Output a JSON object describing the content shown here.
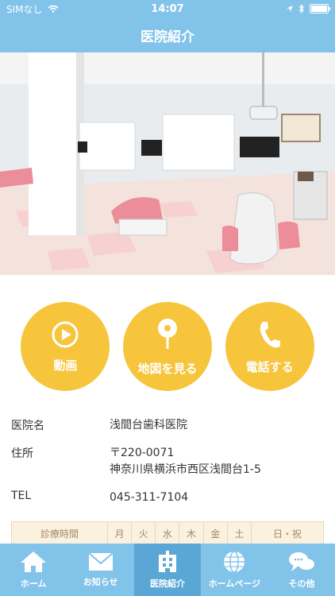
{
  "status": {
    "carrier": "SIMなし",
    "time": "14:07"
  },
  "navbar": {
    "title": "医院紹介"
  },
  "actions": [
    {
      "label": "動画",
      "icon": "play-icon"
    },
    {
      "label": "地図を見る",
      "icon": "map-pin-icon"
    },
    {
      "label": "電話する",
      "icon": "phone-icon"
    }
  ],
  "info": {
    "name_key": "医院名",
    "name_value": "浅間台歯科医院",
    "address_key": "住所",
    "address_zip": "〒220-0071",
    "address_line": "神奈川県横浜市西区浅間台1-5",
    "tel_key": "TEL",
    "tel_value": "045-311-7104"
  },
  "hours": {
    "header": [
      "診療時間",
      "月",
      "火",
      "水",
      "木",
      "金",
      "土",
      "日・祝"
    ]
  },
  "tabs": [
    {
      "label": "ホーム",
      "icon": "home-icon"
    },
    {
      "label": "お知らせ",
      "icon": "mail-icon"
    },
    {
      "label": "医院紹介",
      "icon": "hospital-icon",
      "active": true
    },
    {
      "label": "ホームページ",
      "icon": "globe-icon"
    },
    {
      "label": "その他",
      "icon": "chat-bubbles-icon"
    }
  ],
  "colors": {
    "accent": "#82c3ea",
    "button": "#f6c53b"
  }
}
